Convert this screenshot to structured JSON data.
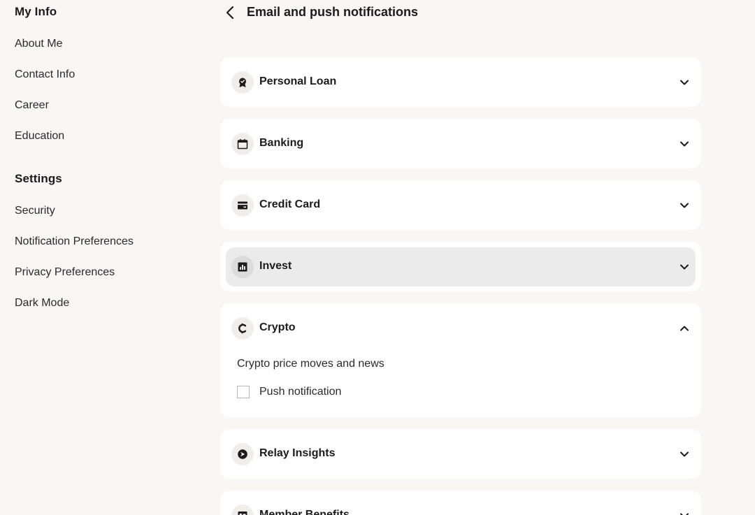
{
  "sidebar": {
    "my_info_heading": "My Info",
    "my_info_items": [
      {
        "label": "About Me"
      },
      {
        "label": "Contact Info"
      },
      {
        "label": "Career"
      },
      {
        "label": "Education"
      }
    ],
    "settings_heading": "Settings",
    "settings_items": [
      {
        "label": "Security"
      },
      {
        "label": "Notification Preferences"
      },
      {
        "label": "Privacy Preferences"
      },
      {
        "label": "Dark Mode"
      }
    ]
  },
  "header": {
    "back_icon": "chevron-left-icon",
    "title": "Email and push notifications"
  },
  "sections": [
    {
      "label": "Personal Loan",
      "icon": "badge-icon",
      "expanded": false
    },
    {
      "label": "Banking",
      "icon": "calendar-icon",
      "expanded": false
    },
    {
      "label": "Credit Card",
      "icon": "credit-card-icon",
      "expanded": false
    },
    {
      "label": "Invest",
      "icon": "bar-chart-icon",
      "expanded": false,
      "hovered": true
    },
    {
      "label": "Crypto",
      "icon": "crypto-icon",
      "expanded": true,
      "content": {
        "subtitle": "Crypto price moves and news",
        "options": [
          {
            "label": "Push notification",
            "checked": false
          }
        ]
      }
    },
    {
      "label": "Relay Insights",
      "icon": "relay-icon",
      "expanded": false
    },
    {
      "label": "Member Benefits",
      "icon": "card-list-icon",
      "expanded": false
    }
  ],
  "colors": {
    "background": "#f8f7f4",
    "card": "#ffffff",
    "hover": "#ebebeb",
    "text": "#1b1b1b"
  }
}
